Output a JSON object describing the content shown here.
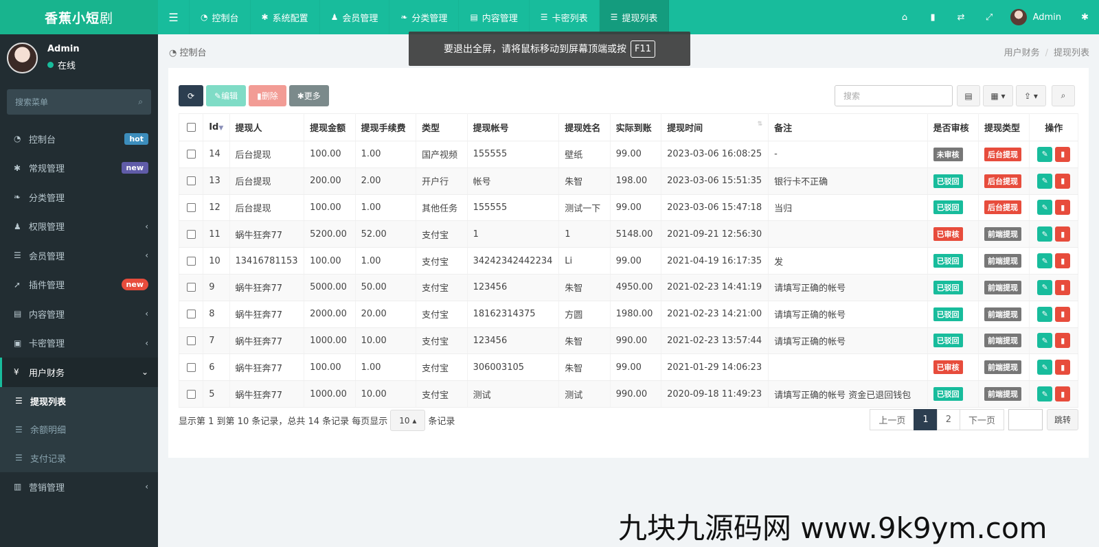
{
  "app": {
    "logo_main": "香蕉小短",
    "logo_suffix": "剧"
  },
  "topnav": {
    "toggle_icon": "bars-icon",
    "items": [
      {
        "icon": "dashboard-icon",
        "glyph": "◔",
        "label": "控制台"
      },
      {
        "icon": "gears-icon",
        "glyph": "✱",
        "label": "系统配置"
      },
      {
        "icon": "user-icon",
        "glyph": "♟",
        "label": "会员管理"
      },
      {
        "icon": "leaf-icon",
        "glyph": "❧",
        "label": "分类管理"
      },
      {
        "icon": "file-icon",
        "glyph": "▤",
        "label": "内容管理"
      },
      {
        "icon": "list-icon",
        "glyph": "☰",
        "label": "卡密列表"
      },
      {
        "icon": "list-icon",
        "glyph": "☰",
        "label": "提现列表"
      }
    ],
    "right_icons": [
      "home-icon",
      "trash-icon",
      "translate-icon",
      "fullscreen-icon"
    ],
    "admin_name": "Admin",
    "settings_icon": "gears-icon"
  },
  "sidebar": {
    "user_name": "Admin",
    "user_status": "在线",
    "search_placeholder": "搜索菜单",
    "menu": [
      {
        "label": "控制台",
        "glyph": "◔",
        "badge": "hot"
      },
      {
        "label": "常规管理",
        "glyph": "✱",
        "badge": "new"
      },
      {
        "label": "分类管理",
        "glyph": "❧"
      },
      {
        "label": "权限管理",
        "glyph": "♟"
      },
      {
        "label": "会员管理",
        "glyph": "☰"
      },
      {
        "label": "插件管理",
        "glyph": "➚",
        "badge": "new"
      },
      {
        "label": "内容管理",
        "glyph": "▤"
      },
      {
        "label": "卡密管理",
        "glyph": "▣"
      },
      {
        "label": "用户财务",
        "glyph": "¥"
      }
    ],
    "submenu": [
      {
        "label": "提现列表"
      },
      {
        "label": "余额明细"
      },
      {
        "label": "支付记录"
      }
    ],
    "last_menu": {
      "label": "营销管理",
      "glyph": "▥"
    }
  },
  "breadcrumb": {
    "left": "控制台",
    "right_parent": "用户财务",
    "right_current": "提现列表"
  },
  "fullscreen_tip": {
    "text": "要退出全屏，请将鼠标移动到屏幕顶端或按",
    "key": "F11"
  },
  "toolbar": {
    "edit": "编辑",
    "delete": "删除",
    "more": "更多",
    "search_placeholder": "搜索"
  },
  "table": {
    "headers": [
      "Id",
      "提现人",
      "提现金额",
      "提现手续费",
      "类型",
      "提现帐号",
      "提现姓名",
      "实际到账",
      "提现时间",
      "备注",
      "是否审核",
      "提现类型",
      "操作"
    ],
    "rows": [
      {
        "id": "14",
        "user": "后台提现",
        "amount": "100.00",
        "fee": "1.00",
        "type": "国产视频",
        "account": "155555",
        "name": "壁纸",
        "actual": "99.00",
        "time": "2023-03-06 16:08:25",
        "remark": "-",
        "audit": "未审核",
        "audit_color": "gray",
        "wtype": "后台提现",
        "wtype_color": "red"
      },
      {
        "id": "13",
        "user": "后台提现",
        "amount": "200.00",
        "fee": "2.00",
        "type": "开户行",
        "account": "帐号",
        "name": "朱智",
        "actual": "198.00",
        "time": "2023-03-06 15:51:35",
        "remark": "银行卡不正确",
        "audit": "已驳回",
        "audit_color": "green",
        "wtype": "后台提现",
        "wtype_color": "red"
      },
      {
        "id": "12",
        "user": "后台提现",
        "amount": "100.00",
        "fee": "1.00",
        "type": "其他任务",
        "account": "155555",
        "name": "测试一下",
        "actual": "99.00",
        "time": "2023-03-06 15:47:18",
        "remark": "当归",
        "audit": "已驳回",
        "audit_color": "green",
        "wtype": "后台提现",
        "wtype_color": "red"
      },
      {
        "id": "11",
        "user": "蜗牛狂奔77",
        "amount": "5200.00",
        "fee": "52.00",
        "type": "支付宝",
        "account": "1",
        "name": "1",
        "actual": "5148.00",
        "time": "2021-09-21 12:56:30",
        "remark": "",
        "audit": "已审核",
        "audit_color": "red",
        "wtype": "前端提现",
        "wtype_color": "gray"
      },
      {
        "id": "10",
        "user": "13416781153",
        "amount": "100.00",
        "fee": "1.00",
        "type": "支付宝",
        "account": "34242342442234",
        "name": "Li",
        "actual": "99.00",
        "time": "2021-04-19 16:17:35",
        "remark": "发",
        "audit": "已驳回",
        "audit_color": "green",
        "wtype": "前端提现",
        "wtype_color": "gray"
      },
      {
        "id": "9",
        "user": "蜗牛狂奔77",
        "amount": "5000.00",
        "fee": "50.00",
        "type": "支付宝",
        "account": "123456",
        "name": "朱智",
        "actual": "4950.00",
        "time": "2021-02-23 14:41:19",
        "remark": "请填写正确的帐号",
        "audit": "已驳回",
        "audit_color": "green",
        "wtype": "前端提现",
        "wtype_color": "gray"
      },
      {
        "id": "8",
        "user": "蜗牛狂奔77",
        "amount": "2000.00",
        "fee": "20.00",
        "type": "支付宝",
        "account": "18162314375",
        "name": "方圆",
        "actual": "1980.00",
        "time": "2021-02-23 14:21:00",
        "remark": "请填写正确的帐号",
        "audit": "已驳回",
        "audit_color": "green",
        "wtype": "前端提现",
        "wtype_color": "gray"
      },
      {
        "id": "7",
        "user": "蜗牛狂奔77",
        "amount": "1000.00",
        "fee": "10.00",
        "type": "支付宝",
        "account": "123456",
        "name": "朱智",
        "actual": "990.00",
        "time": "2021-02-23 13:57:44",
        "remark": "请填写正确的帐号",
        "audit": "已驳回",
        "audit_color": "green",
        "wtype": "前端提现",
        "wtype_color": "gray"
      },
      {
        "id": "6",
        "user": "蜗牛狂奔77",
        "amount": "100.00",
        "fee": "1.00",
        "type": "支付宝",
        "account": "306003105",
        "name": "朱智",
        "actual": "99.00",
        "time": "2021-01-29 14:06:23",
        "remark": "",
        "audit": "已审核",
        "audit_color": "red",
        "wtype": "前端提现",
        "wtype_color": "gray"
      },
      {
        "id": "5",
        "user": "蜗牛狂奔77",
        "amount": "1000.00",
        "fee": "10.00",
        "type": "支付宝",
        "account": "测试",
        "name": "测试",
        "actual": "990.00",
        "time": "2020-09-18 11:49:23",
        "remark": "请填写正确的帐号 资金已退回钱包",
        "audit": "已驳回",
        "audit_color": "green",
        "wtype": "前端提现",
        "wtype_color": "gray"
      }
    ]
  },
  "pagination": {
    "info_before": "显示第 1 到第 10 条记录，总共 14 条记录 每页显示",
    "page_size": "10",
    "info_after": "条记录",
    "prev": "上一页",
    "pages": [
      "1",
      "2"
    ],
    "current": "1",
    "next": "下一页",
    "jump": "跳转"
  },
  "watermark": "九块九源码网 www.9k9ym.com"
}
